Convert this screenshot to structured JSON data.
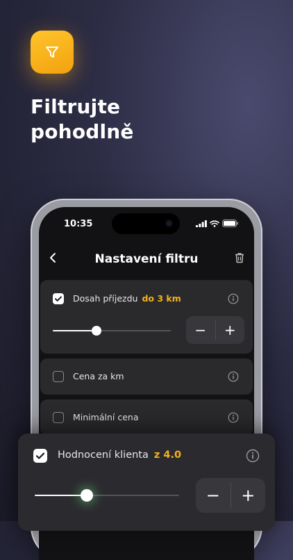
{
  "promo": {
    "line1": "Filtrujte",
    "line2": "pohodlně",
    "app_icon": "filter-icon",
    "accent_color": "#F4B21C"
  },
  "status_bar": {
    "time": "10:35",
    "icons": [
      "signal-icon",
      "wifi-icon",
      "battery-icon"
    ]
  },
  "header": {
    "title": "Nastavení filtru",
    "back_icon": "chevron-left-icon",
    "delete_icon": "trash-icon"
  },
  "filters": [
    {
      "label": "Dosah příjezdu",
      "value": "do 3 km",
      "checked": true,
      "slider_fraction": 0.37
    },
    {
      "label": "Cena za km",
      "checked": false
    },
    {
      "label": "Minimální cena",
      "checked": false
    },
    {
      "label": "Hodnocení klienta",
      "value": "z 4.0",
      "checked": true,
      "slider_fraction": 0.36
    }
  ],
  "stepper": {
    "minus": "−",
    "plus": "+"
  }
}
